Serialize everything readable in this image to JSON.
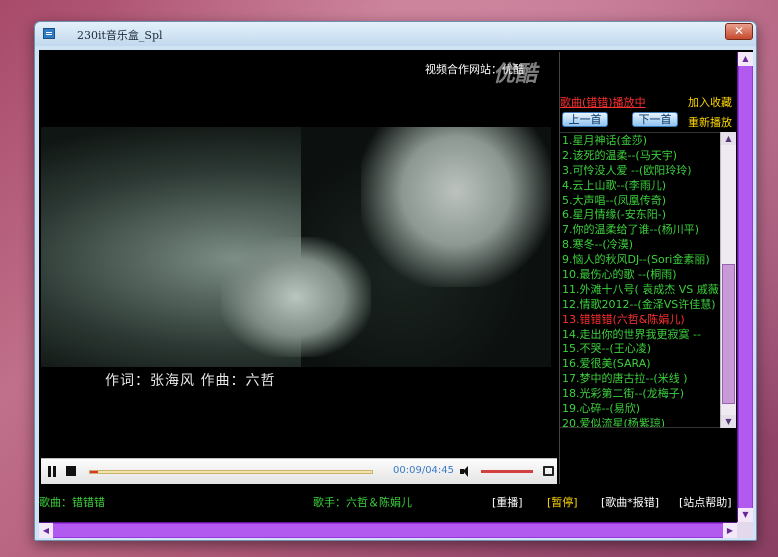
{
  "window": {
    "title": "230it音乐盒_Spl",
    "close_label": "✕"
  },
  "video": {
    "watermark_text": "视频合作网站：优酷",
    "watermark_logo": "优酷",
    "subtitle": "作词：张海风    作曲：六哲"
  },
  "player": {
    "time": "00:09/04:45",
    "progress": 0.03,
    "volume": 1.0
  },
  "playlist": {
    "now_playing_label": "歌曲(错错)播放中",
    "favorite_label": "加入收藏",
    "prev_label": "上一首",
    "next_label": "下一首",
    "replay_label": "重新播放",
    "active_index": 12,
    "songs": [
      "1.星月神话(金莎)",
      "2.该死的温柔--(马天宇)",
      "3.可怜没人爱 --(欧阳玲玲)",
      "4.云上山歌--(李雨儿)",
      "5.大声唱--(凤凰传奇)",
      "6.星月情缘(-安东阳-)",
      "7.你的温柔给了谁--(杨川平)",
      "8.寒冬--(冷漠)",
      "9.恼人的秋风DJ--(Sori金素丽)",
      "10.最伤心的歌 --(桐雨)",
      "11.外滩十八号( 袁成杰 VS 戚薇)",
      "12.情歌2012--(金泽VS许佳慧)",
      "13.错错错(六哲&陈娟儿)",
      "14.走出你的世界我更寂寞 --",
      "15.不哭--(王心凌)",
      "16.爱很美(SARA)",
      "17.梦中的唐古拉--(米线 )",
      "18.光彩第二街--(龙梅子)",
      "19.心碎--(易欣)",
      "20.爱似流星(杨紫琼)"
    ]
  },
  "info_bar": {
    "song": "歌曲：错错错",
    "artist": "歌手：六哲＆陈娟儿",
    "replay": "[重播]",
    "pause": "[暂停]",
    "report": "[歌曲*报错]",
    "help": "[站点帮助]"
  },
  "colors": {
    "accent_purple": "#9b33e0",
    "playlist_green": "#3cd13c",
    "active_red": "#ff3030",
    "gold": "#ffd700"
  },
  "icons": {
    "pause": "pause-icon",
    "stop": "stop-icon",
    "volume": "volume-icon",
    "screen": "screen-icon",
    "close": "close-icon"
  }
}
